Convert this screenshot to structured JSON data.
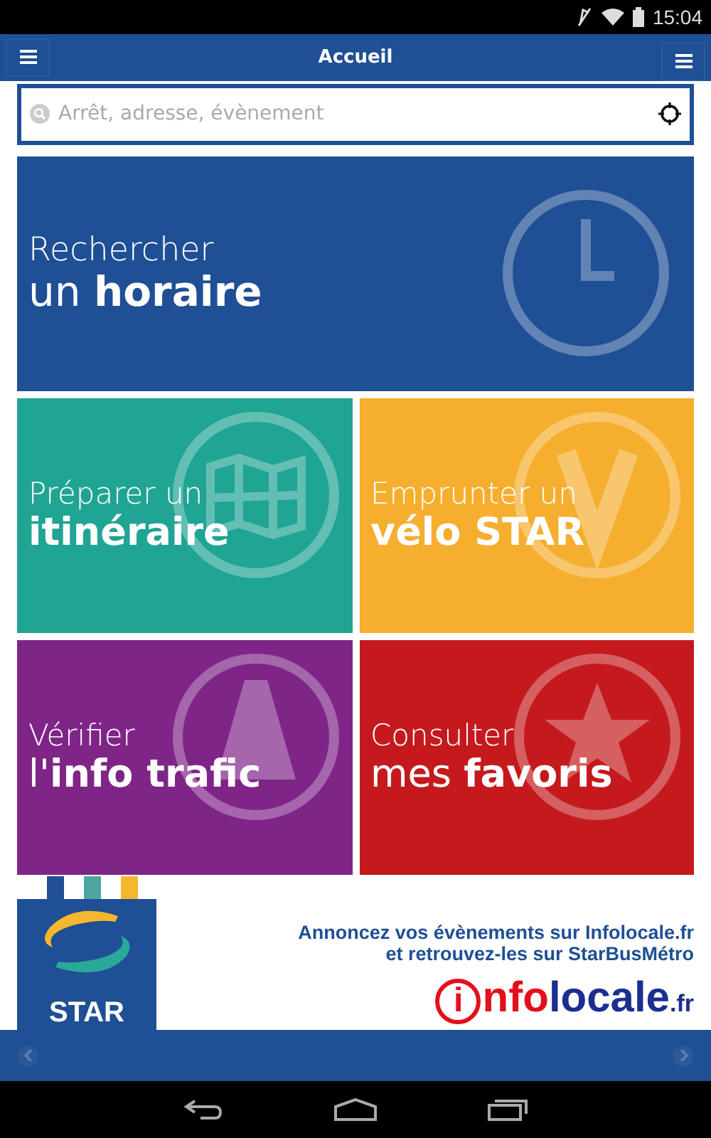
{
  "status_bar": {
    "time": "15:04"
  },
  "app_bar": {
    "title": "Accueil"
  },
  "search": {
    "placeholder": "Arrêt, adresse, évènement"
  },
  "tiles": [
    {
      "kind": "clock",
      "line_1": "Rechercher",
      "line_2": "un **horaire**",
      "color": "#1f4f94"
    },
    {
      "kind": "map",
      "line_1": "Préparer un",
      "line_2": "**itinéraire**",
      "color": "#20a493"
    },
    {
      "kind": "bike",
      "line_1": "Emprunter un",
      "line_2": "**vélo STAR**",
      "color": "#f5ae2e"
    },
    {
      "kind": "cone",
      "line_1": "Vérifier",
      "line_2": "l'**info trafic**",
      "color": "#7e2587"
    },
    {
      "kind": "star",
      "line_1": "Consulter",
      "line_2": "mes **favoris**",
      "color": "#c41a1e"
    }
  ],
  "banner": {
    "logo_text": "STAR",
    "message": [
      "Annoncez vos évènements sur Infolocale.fr",
      "et retrouvez-les sur StarBusMétro"
    ],
    "brand_parts": [
      "i",
      "nfo",
      "locale",
      ".fr"
    ]
  }
}
